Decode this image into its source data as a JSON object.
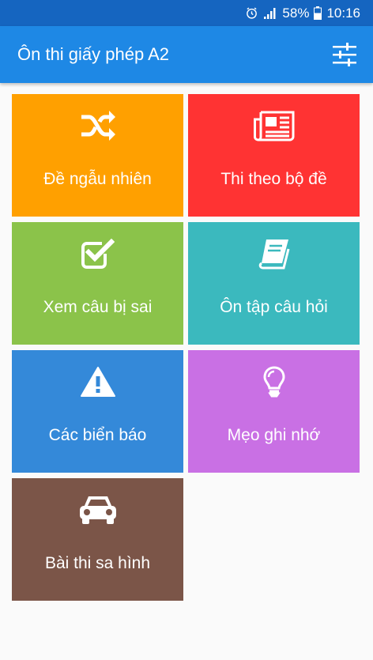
{
  "status_bar": {
    "battery": "58%",
    "time": "10:16",
    "icons": [
      "alarm-icon",
      "signal-icon",
      "battery-icon"
    ]
  },
  "app_bar": {
    "title": "Ôn thi giấy phép A2",
    "action_icon": "settings-sliders-icon"
  },
  "tiles": [
    {
      "label": "Đề ngẫu nhiên",
      "icon": "shuffle-icon",
      "color": "#ffa000"
    },
    {
      "label": "Thi theo bộ đề",
      "icon": "newspaper-icon",
      "color": "#ff3333"
    },
    {
      "label": "Xem câu bị sai",
      "icon": "checkbox-icon",
      "color": "#8bc34a"
    },
    {
      "label": "Ôn tập câu hỏi",
      "icon": "book-icon",
      "color": "#3bb9be"
    },
    {
      "label": "Các biển báo",
      "icon": "warning-icon",
      "color": "#3489d9"
    },
    {
      "label": "Mẹo ghi nhớ",
      "icon": "lightbulb-icon",
      "color": "#c970e4"
    },
    {
      "label": "Bài thi sa hình",
      "icon": "car-icon",
      "color": "#7b5548"
    }
  ],
  "colors": {
    "status_bar": "#1565c0",
    "app_bar": "#1e88e5",
    "background": "#fafafa"
  }
}
